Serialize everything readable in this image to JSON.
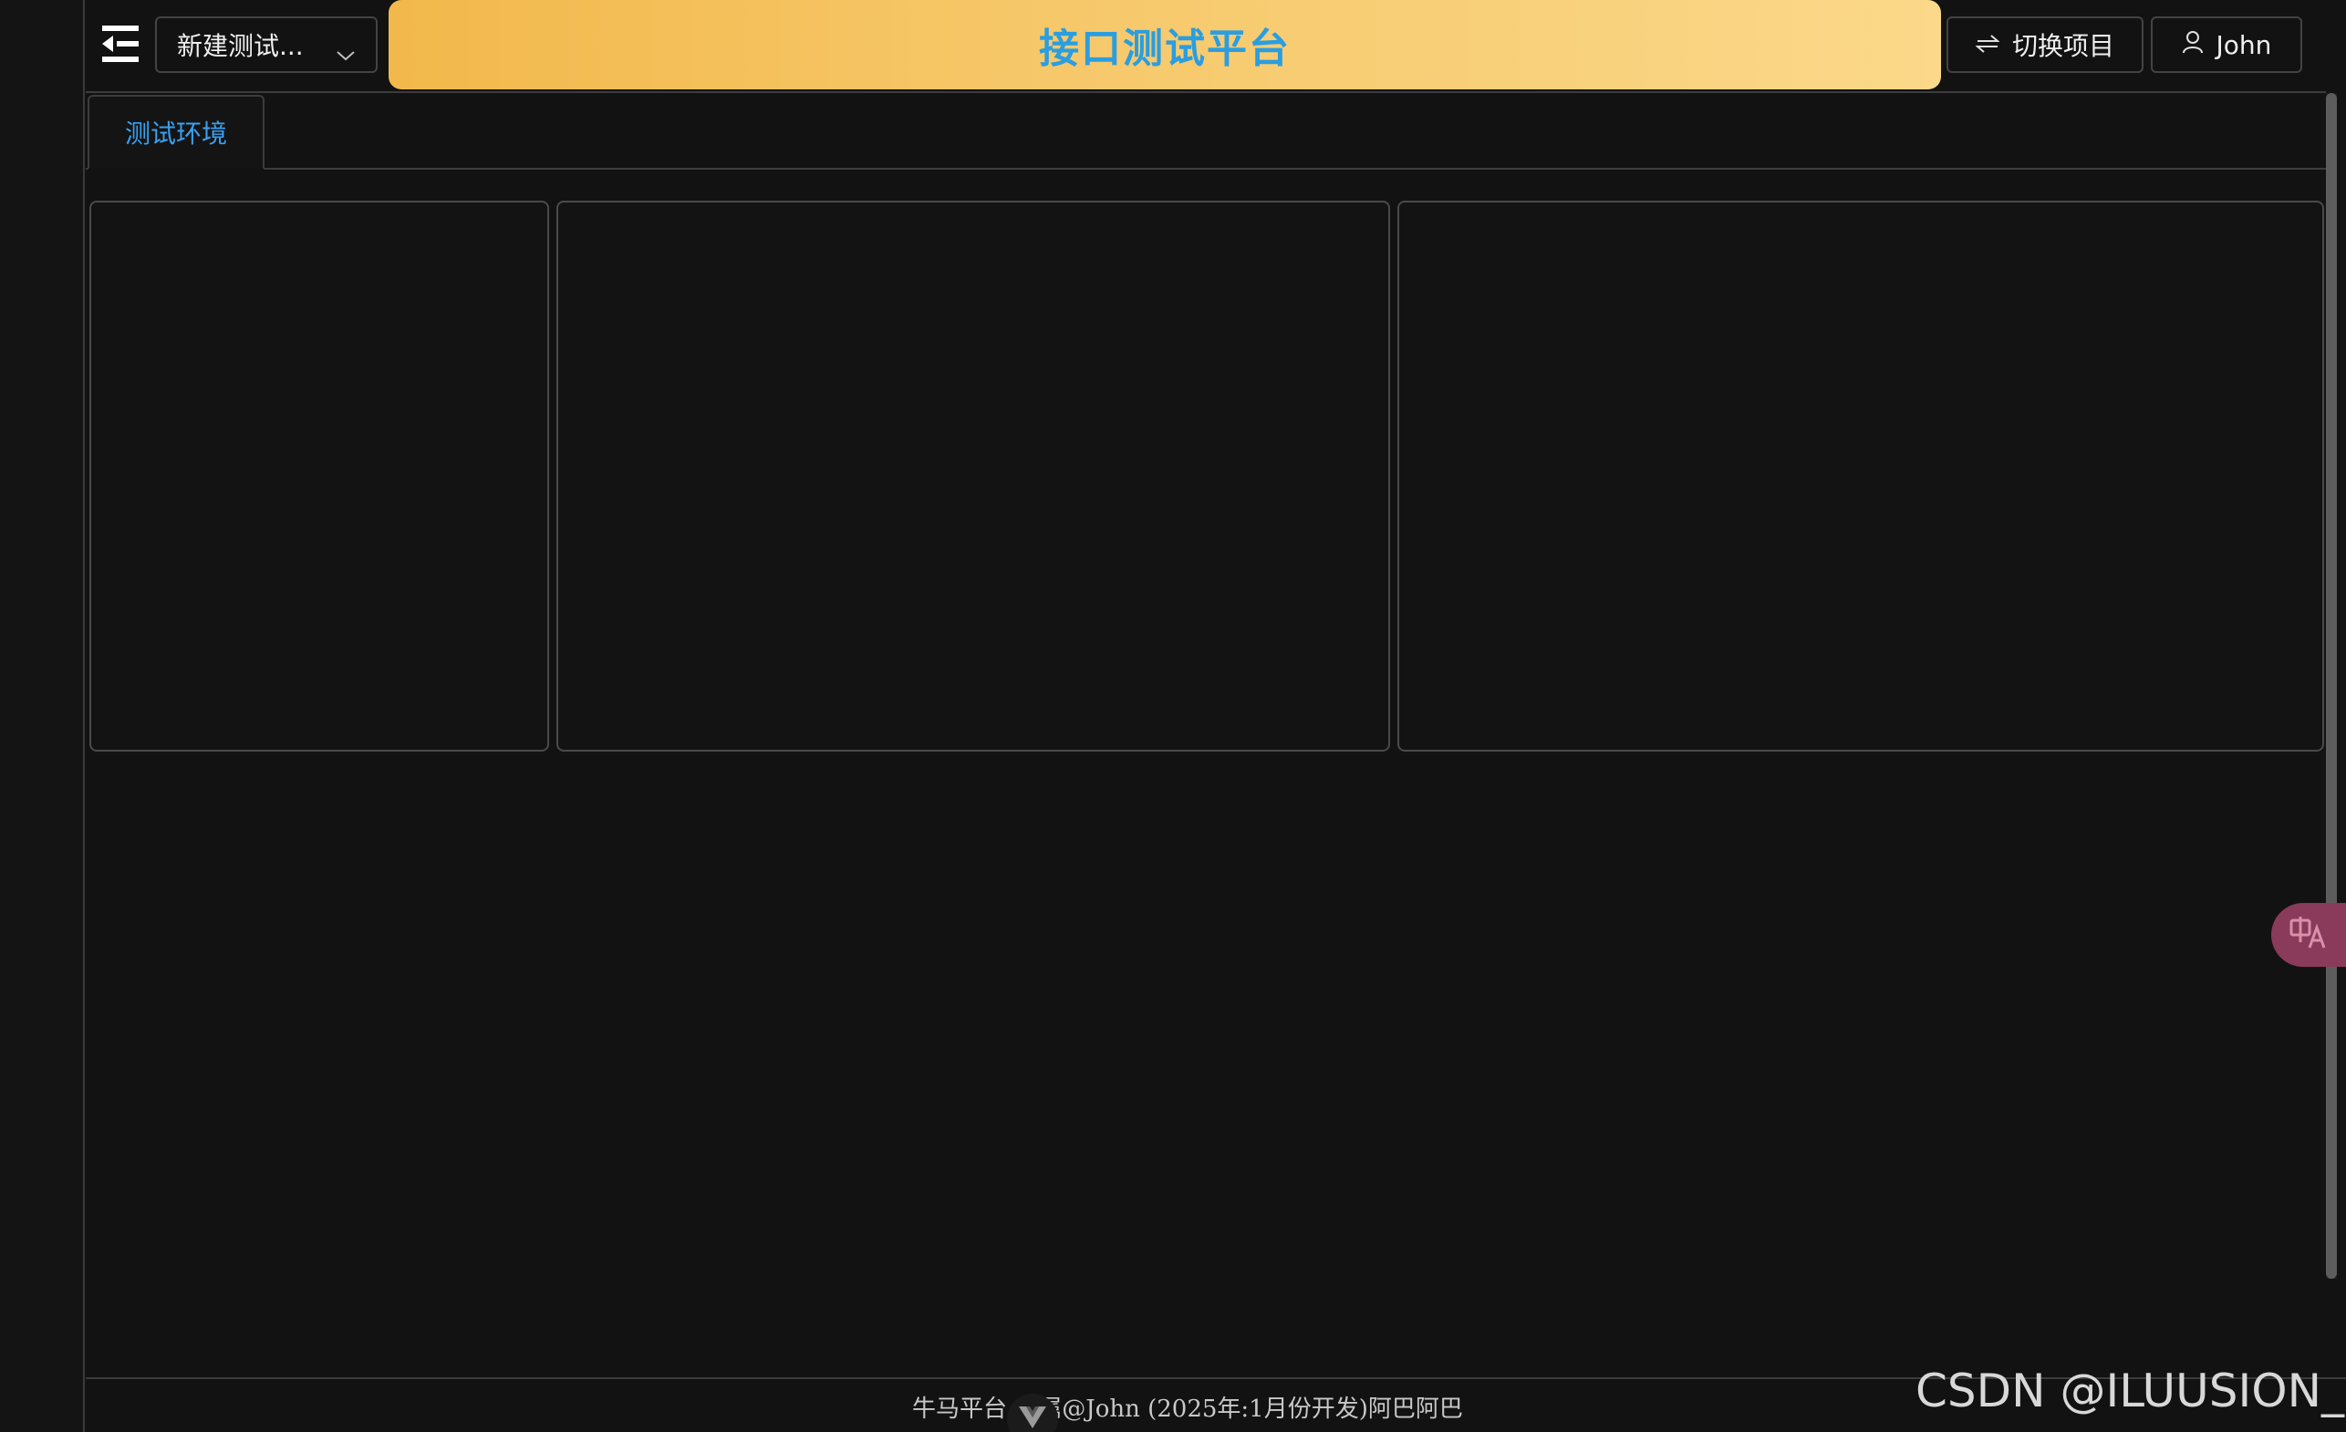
{
  "header": {
    "project_select_value": "新建测试...",
    "title": "接口测试平台",
    "switch_project_label": "切换项目",
    "user_name": "John"
  },
  "tabs": [
    {
      "label": "测试环境",
      "active": true
    }
  ],
  "footer": {
    "text": "牛马平台   归属@John (2025年:1月份开发)阿巴阿巴"
  },
  "watermark": "CSDN @ILUUSION_S",
  "colors": {
    "background": "#121212",
    "banner_start": "#f2b84b",
    "banner_end": "#fbd88a",
    "title_text": "#2a9ee0",
    "active_tab_text": "#3aa0f0"
  },
  "icons": {
    "menu_toggle": "menu-fold-icon",
    "select_arrow": "chevron-down-icon",
    "switch": "swap-icon",
    "user": "user-icon",
    "footer_badge": "vue-logo-icon",
    "translate": "translate-icon"
  }
}
